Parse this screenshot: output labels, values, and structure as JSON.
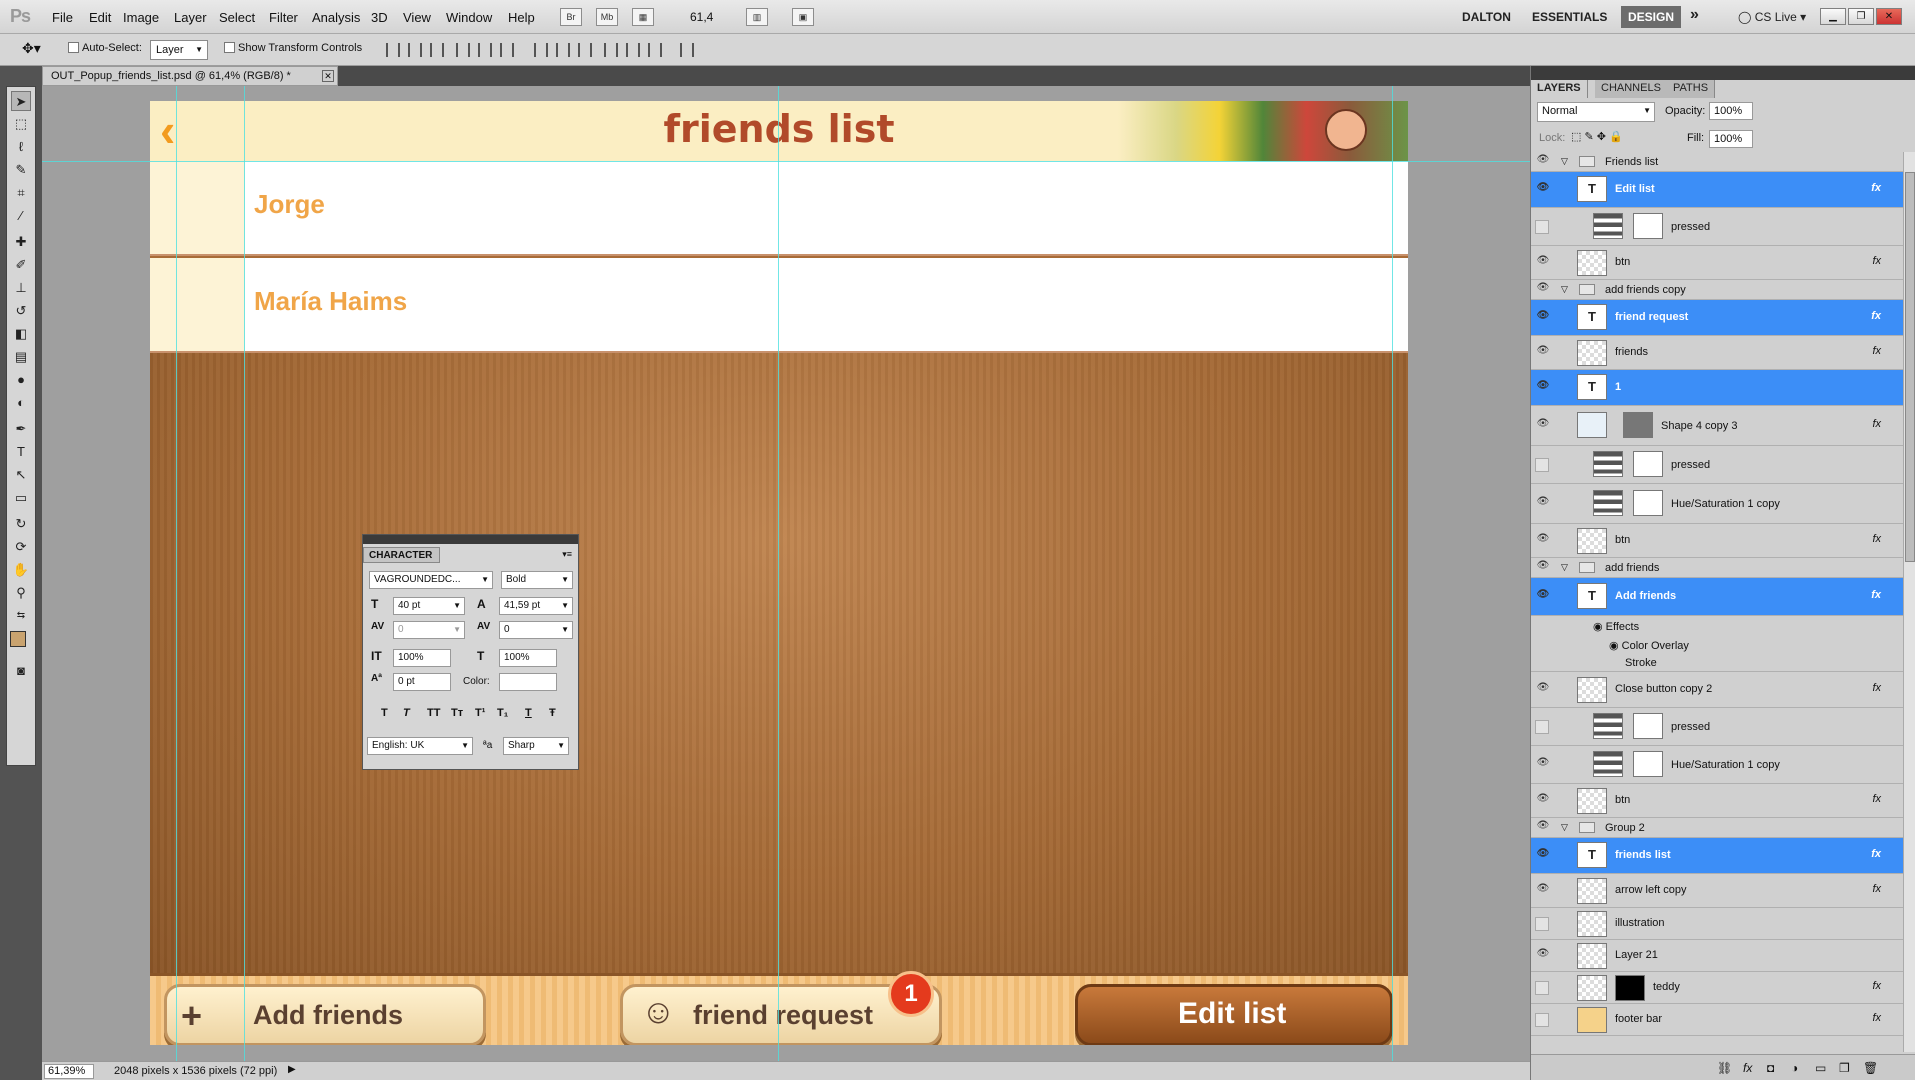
{
  "app": {
    "logo": "Ps"
  },
  "menu": [
    "File",
    "Edit",
    "Image",
    "Layer",
    "Select",
    "Filter",
    "Analysis",
    "3D",
    "View",
    "Window",
    "Help"
  ],
  "appbar": {
    "bridge": "Br",
    "minibridge": "Mb",
    "zoom": "61,4"
  },
  "workspaces": {
    "dalton": "DALTON",
    "essentials": "ESSENTIALS",
    "design": "DESIGN",
    "more": "»",
    "cslive": "CS Live"
  },
  "options": {
    "auto_select": "Auto-Select:",
    "layer_select": "Layer",
    "transform": "Show Transform Controls"
  },
  "document": {
    "tab": "OUT_Popup_friends_list.psd @ 61,4% (RGB/8) *"
  },
  "canvas": {
    "title": "friends list",
    "back": "‹",
    "rows": [
      "Jorge",
      "María Haims"
    ],
    "buttons": {
      "add": "Add friends",
      "add_icon": "+",
      "request": "friend request",
      "request_icon": "☺",
      "edit": "Edit list"
    },
    "badge": "1"
  },
  "status": {
    "zoom": "61,39%",
    "info": "2048 pixels x 1536 pixels (72 ppi)"
  },
  "character": {
    "tab": "CHARACTER",
    "font": "VAGROUNDEDC...",
    "style": "Bold",
    "size": "40 pt",
    "leading": "41,59 pt",
    "kerning": "0",
    "tracking": "0",
    "vscale": "100%",
    "hscale": "100%",
    "baseline": "0 pt",
    "color_label": "Color:",
    "language": "English: UK",
    "aa_label": "ªa",
    "antialias": "Sharp",
    "styles": [
      "T",
      "T",
      "TT",
      "Tт",
      "T¹",
      "T₁",
      "T",
      "Ŧ"
    ]
  },
  "layers_panel": {
    "tabs": [
      "LAYERS",
      "CHANNELS",
      "PATHS"
    ],
    "blend": "Normal",
    "opacity_label": "Opacity:",
    "opacity": "100%",
    "lock_label": "Lock:",
    "fill_label": "Fill:",
    "fill": "100%",
    "fx": "fx",
    "items": [
      "Friends list",
      "Edit list",
      "pressed",
      "btn",
      "add friends copy",
      "friend request",
      "friends",
      "1",
      "Shape 4 copy 3",
      "pressed",
      "Hue/Saturation 1 copy",
      "btn",
      "add friends",
      "Add friends",
      "Effects",
      "Color Overlay",
      "Stroke",
      "Close button copy 2",
      "pressed",
      "Hue/Saturation 1 copy",
      "btn",
      "Group 2",
      "friends list",
      "arrow left copy",
      "illustration",
      "Layer 21",
      "teddy",
      "footer bar"
    ]
  },
  "colors": {
    "selection": "#3c8ef7",
    "title": "#b14a2a",
    "names": "#f0a548",
    "badge": "#e43a1d",
    "guides": "#4ee0e0"
  }
}
